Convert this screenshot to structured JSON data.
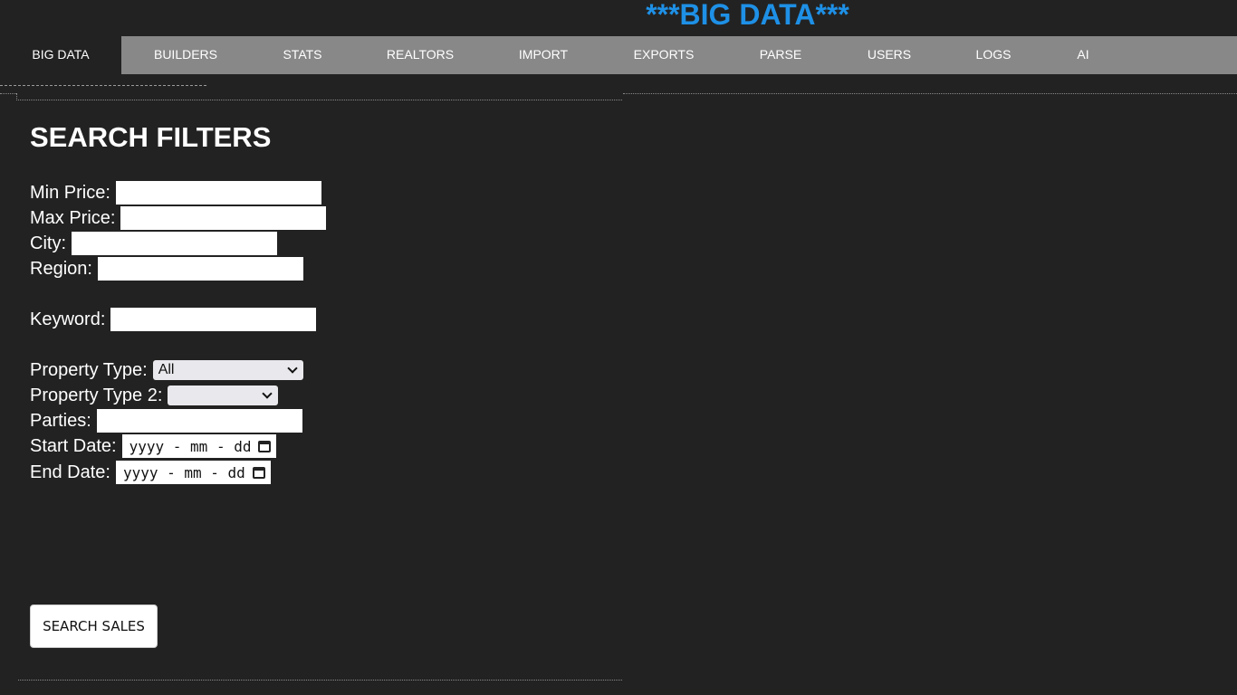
{
  "app": {
    "title": "***BIG DATA***"
  },
  "nav": {
    "tabs": [
      {
        "label": "BIG DATA",
        "active": true
      },
      {
        "label": "BUILDERS",
        "active": false
      },
      {
        "label": "STATS",
        "active": false
      },
      {
        "label": "REALTORS",
        "active": false
      },
      {
        "label": "IMPORT",
        "active": false
      },
      {
        "label": "EXPORTS",
        "active": false
      },
      {
        "label": "PARSE",
        "active": false
      },
      {
        "label": "USERS",
        "active": false
      },
      {
        "label": "LOGS",
        "active": false
      },
      {
        "label": "AI",
        "active": false
      }
    ]
  },
  "filters": {
    "heading": "SEARCH FILTERS",
    "min_price": {
      "label": "Min Price:",
      "value": ""
    },
    "max_price": {
      "label": "Max Price:",
      "value": ""
    },
    "city": {
      "label": "City:",
      "value": ""
    },
    "region": {
      "label": "Region:",
      "value": ""
    },
    "keyword": {
      "label": "Keyword:",
      "value": ""
    },
    "property_type": {
      "label": "Property Type:",
      "selected": "All"
    },
    "property_type_2": {
      "label": "Property Type 2:",
      "selected": ""
    },
    "parties": {
      "label": "Parties:",
      "value": ""
    },
    "start_date": {
      "label": "Start Date:",
      "placeholder": "yyyy - mm - dd"
    },
    "end_date": {
      "label": "End Date:",
      "placeholder": "yyyy - mm - dd"
    },
    "search_button": "SEARCH SALES"
  },
  "colors": {
    "background": "#222222",
    "nav_background": "#888888",
    "title_accent": "#1e90e6"
  }
}
